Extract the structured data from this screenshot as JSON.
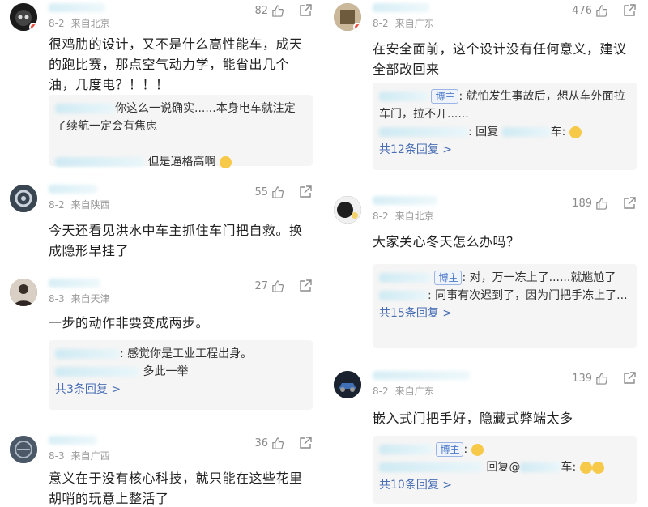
{
  "left": [
    {
      "date": "8-2",
      "location": "来自北京",
      "likes": "82",
      "text": "很鸡肋的设计，又不是什么高性能车，成天的跑比赛，那点空气动力学，能省出几个油，几度电？！！！",
      "replies": [
        {
          "text": "你这么一说确实......本身电车就注定了续航一定会有焦虑"
        },
        {
          "text": "但是逼格高啊"
        }
      ],
      "more": ""
    },
    {
      "date": "8-2",
      "location": "来自陕西",
      "likes": "55",
      "text": "今天还看见洪水中车主抓住车门把自救。换成隐形早挂了",
      "replies": [],
      "more": ""
    },
    {
      "date": "8-3",
      "location": "来自天津",
      "likes": "27",
      "text": "一步的动作非要变成两步。",
      "replies": [
        {
          "text": ": 感觉你是工业工程出身。"
        },
        {
          "text": "多此一举"
        }
      ],
      "more": "共3条回复 >"
    },
    {
      "date": "8-3",
      "location": "来自广西",
      "likes": "36",
      "text": "意义在于没有核心科技，就只能在这些花里胡哨的玩意上整活了",
      "replies": [],
      "more": ""
    }
  ],
  "right": [
    {
      "date": "8-2",
      "location": "来自广东",
      "likes": "476",
      "text": "在安全面前，这个设计没有任何意义，建议全部改回来",
      "replies": [
        {
          "tag": "博主",
          "text": ": 就怕发生事故后，想从车外面拉车门，拉不开......"
        },
        {
          "text": ": 回复",
          "suffix": "车:"
        }
      ],
      "more": "共12条回复 >"
    },
    {
      "date": "8-2",
      "location": "来自北京",
      "likes": "189",
      "text": "大家关心冬天怎么办吗？",
      "replies": [
        {
          "tag": "博主",
          "text": ": 对，万一冻上了......就尴尬了"
        },
        {
          "text": ": 同事有次迟到了，因为门把手冻上了..."
        }
      ],
      "more": "共15条回复 >"
    },
    {
      "date": "8-2",
      "location": "来自广东",
      "likes": "139",
      "text": "嵌入式门把手好，隐藏式弊端太多",
      "replies": [
        {
          "tag": "博主",
          "text": ":"
        },
        {
          "text": "回复@",
          "suffix": "车:"
        }
      ],
      "more": "共10条回复 >"
    }
  ],
  "colors": {
    "more": "#4a6fb5",
    "tag": "#4a78c9",
    "badge": "#f04b3a"
  }
}
